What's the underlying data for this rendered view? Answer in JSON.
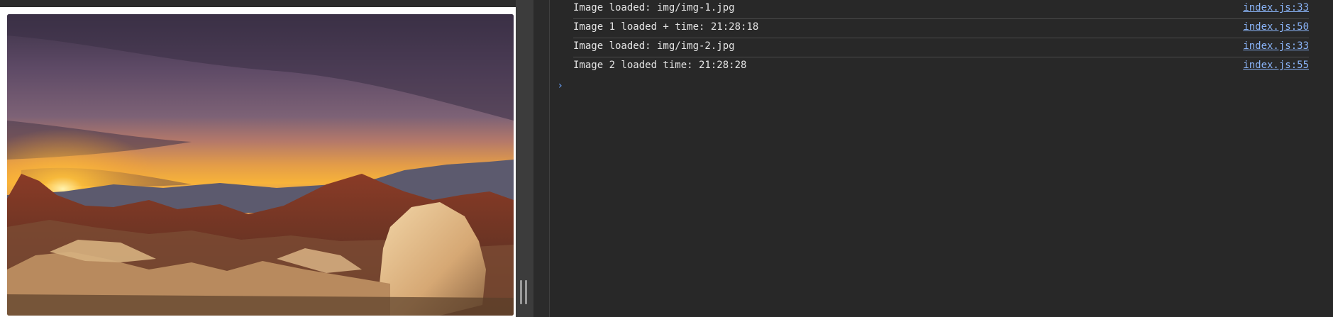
{
  "page": {
    "image_alt": "Desert sunset over red rock mountains"
  },
  "console": {
    "logs": [
      {
        "message": "Image loaded: img/img-1.jpg",
        "source": "index.js:33"
      },
      {
        "message": "Image 1 loaded + time: 21:28:18",
        "source": "index.js:50"
      },
      {
        "message": "Image loaded: img/img-2.jpg",
        "source": "index.js:33"
      },
      {
        "message": "Image 2 loaded time: 21:28:28",
        "source": "index.js:55"
      }
    ],
    "prompt_symbol": "›"
  },
  "colors": {
    "console_bg": "#282828",
    "link": "#8ab4f8",
    "prompt": "#6aa1f8"
  }
}
